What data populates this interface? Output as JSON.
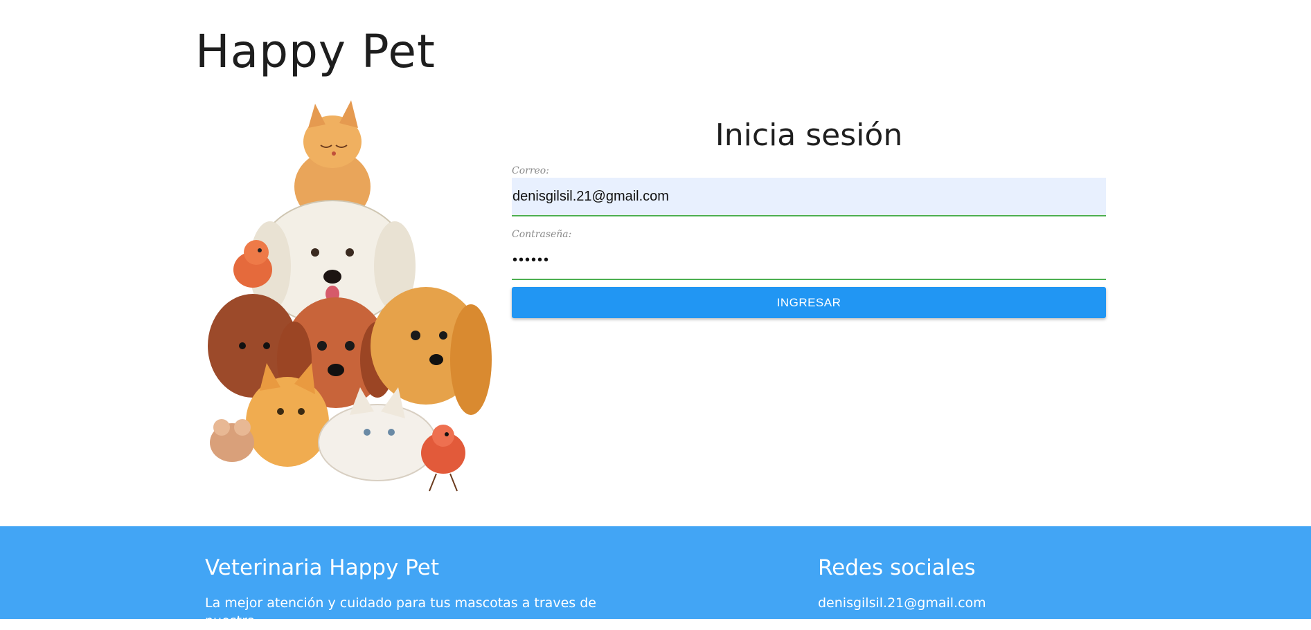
{
  "brand": {
    "title": "Happy Pet"
  },
  "login": {
    "title": "Inicia sesión",
    "email_label": "Correo:",
    "email_value": "denisgilsil.21@gmail.com",
    "password_label": "Contraseña:",
    "password_value": "••••••",
    "submit_label": "INGRESAR"
  },
  "footer": {
    "left_title": "Veterinaria Happy Pet",
    "left_text": "La mejor atención y cuidado para tus mascotas a traves de nuestra",
    "right_title": "Redes sociales",
    "right_email": "denisgilsil.21@gmail.com"
  },
  "colors": {
    "primary": "#2196f3",
    "footer_bg": "#42a5f5",
    "input_focus": "#4caf50",
    "autofill_bg": "#e8f0fe"
  },
  "icons": {
    "illustration": "pets-pyramid-illustration"
  }
}
